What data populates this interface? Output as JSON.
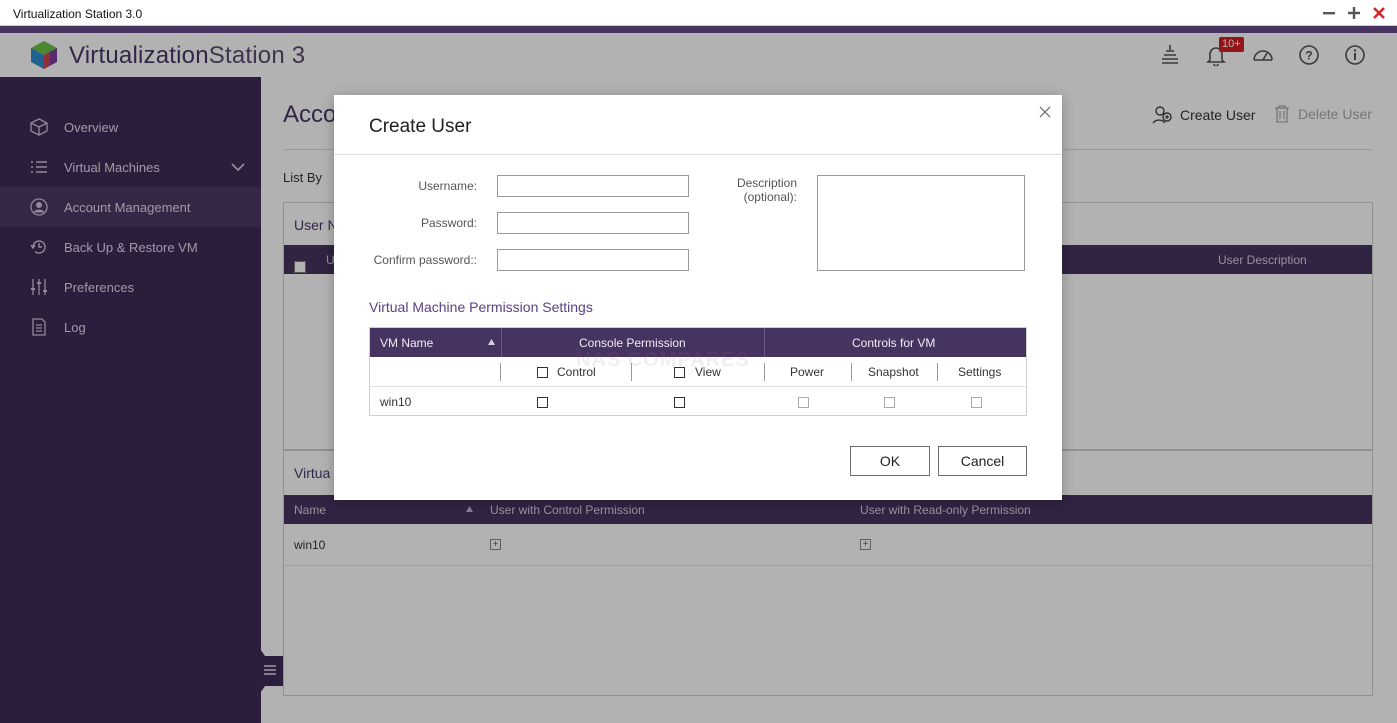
{
  "window": {
    "title": "Virtualization Station 3.0"
  },
  "app": {
    "logo_word1": "Virtualization",
    "logo_word2": "Station 3",
    "notification_count": "10+"
  },
  "colors": {
    "accent": "#47335f",
    "sidebar_bg": "#3e2b56",
    "close_red": "#d9262a",
    "badge_red": "#d31f26"
  },
  "header_icons": [
    "task-icon",
    "bell-icon",
    "dashboard-icon",
    "help-icon",
    "info-icon"
  ],
  "sidebar": {
    "items": [
      {
        "label": "Overview",
        "icon": "overview-icon"
      },
      {
        "label": "Virtual Machines",
        "icon": "list-icon"
      },
      {
        "label": "Account Management",
        "icon": "account-icon"
      },
      {
        "label": "Back Up & Restore VM",
        "icon": "backup-icon"
      },
      {
        "label": "Preferences",
        "icon": "sliders-icon"
      },
      {
        "label": "Log",
        "icon": "log-icon"
      }
    ],
    "active": "Account Management"
  },
  "main": {
    "title": "Acco",
    "create_user": "Create User",
    "delete_user": "Delete User",
    "list_by": "List By",
    "users_panel": {
      "title": "User N",
      "header_partial": "U",
      "header_desc": "User Description"
    },
    "vm_panel": {
      "title": "Virtua",
      "columns": [
        "Name",
        "User with Control Permission",
        "User with Read-only Permission"
      ],
      "rows": [
        {
          "name": "win10"
        }
      ]
    }
  },
  "dialog": {
    "title": "Create User",
    "username_label": "Username:",
    "password_label": "Password:",
    "confirm_label": "Confirm password::",
    "description_label_1": "Description",
    "description_label_2": "(optional):",
    "username_value": "",
    "password_value": "",
    "confirm_value": "",
    "description_value": "",
    "perm_title": "Virtual Machine Permission Settings",
    "perm_table": {
      "headers": [
        "VM Name",
        "Console Permission",
        "Controls for VM"
      ],
      "sub_headers": [
        "Control",
        "View",
        "Power",
        "Snapshot",
        "Settings"
      ],
      "rows": [
        {
          "vm_name": "win10",
          "control": false,
          "view": false,
          "power": false,
          "snapshot": false,
          "settings": false
        }
      ]
    },
    "ok_label": "OK",
    "cancel_label": "Cancel",
    "watermark": "NAS COMPARES"
  }
}
